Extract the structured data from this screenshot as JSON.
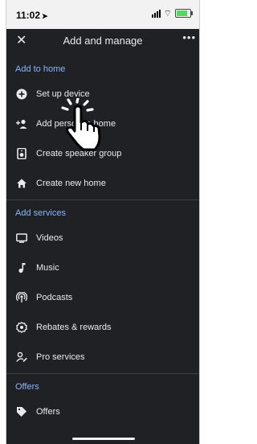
{
  "status_bar": {
    "time": "11:02",
    "battery_level": 0.8
  },
  "header": {
    "title": "Add and manage",
    "close_icon": "close-icon",
    "more_icon": "more-horizontal-icon"
  },
  "sections": {
    "add_to_home": {
      "title": "Add to home",
      "items": [
        {
          "label": "Set up device",
          "icon": "add-circle-icon"
        },
        {
          "label": "Add person to home",
          "icon": "add-person-icon"
        },
        {
          "label": "Create speaker group",
          "icon": "speaker-icon"
        },
        {
          "label": "Create new home",
          "icon": "home-icon"
        }
      ]
    },
    "add_services": {
      "title": "Add services",
      "items": [
        {
          "label": "Videos",
          "icon": "tv-icon"
        },
        {
          "label": "Music",
          "icon": "music-note-icon"
        },
        {
          "label": "Podcasts",
          "icon": "podcast-icon"
        },
        {
          "label": "Rebates & rewards",
          "icon": "rebates-badge-icon"
        },
        {
          "label": "Pro services",
          "icon": "pro-services-icon"
        }
      ]
    },
    "offers": {
      "title": "Offers",
      "items": [
        {
          "label": "Offers",
          "icon": "tag-icon"
        }
      ]
    }
  },
  "colors": {
    "background": "#202124",
    "accent": "#8ab4f8",
    "text": "#e8eaed",
    "divider": "#3c4043"
  }
}
